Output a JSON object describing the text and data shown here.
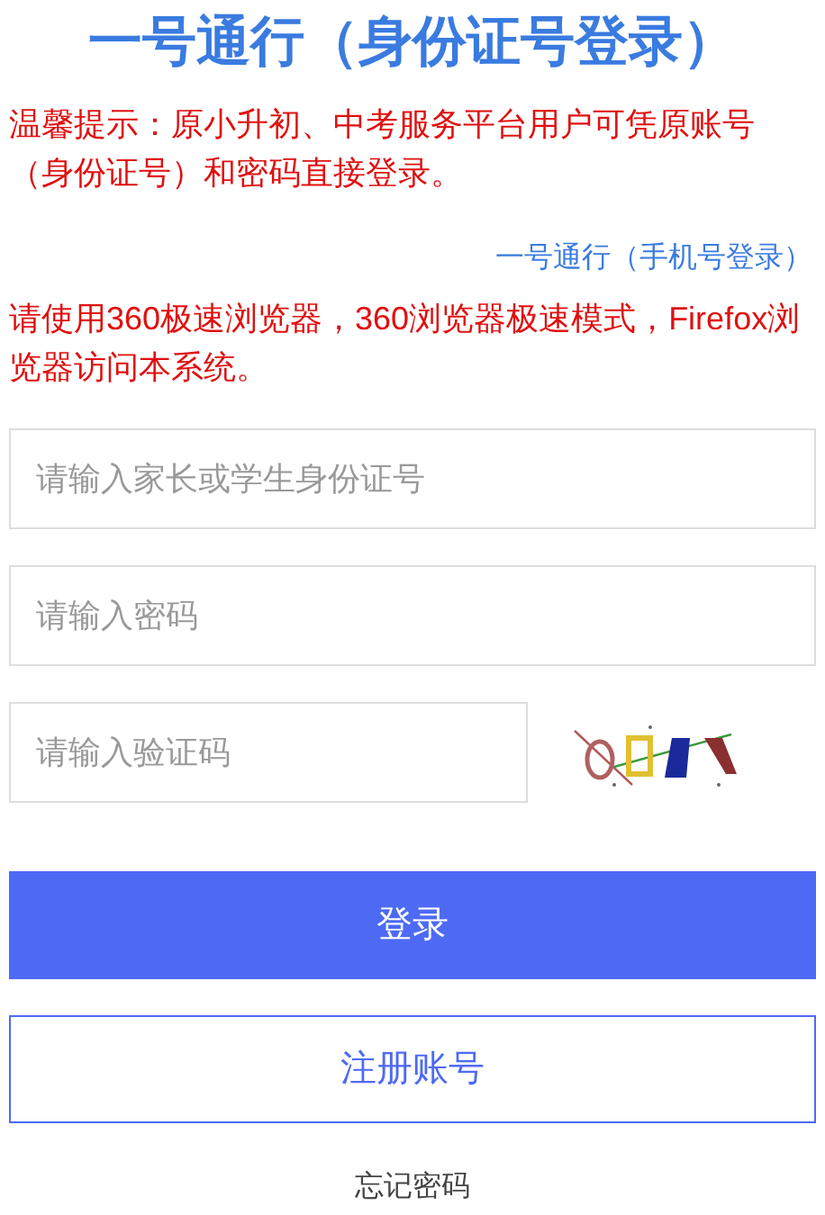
{
  "title": "一号通行（身份证号登录）",
  "notice": "温馨提示：原小升初、中考服务平台用户可凭原账号（身份证号）和密码直接登录。",
  "phone_login_link": "一号通行（手机号登录）",
  "browser_notice": "请使用360极速浏览器，360浏览器极速模式，Firefox浏览器访问本系统。",
  "fields": [
    {
      "kind": "text",
      "placeholder": "请输入家长或学生身份证号"
    },
    {
      "kind": "password",
      "placeholder": "请输入密码"
    },
    {
      "kind": "captcha",
      "placeholder": "请输入验证码"
    }
  ],
  "login_button": "登录",
  "register_button": "注册账号",
  "forgot_password": "忘记密码"
}
